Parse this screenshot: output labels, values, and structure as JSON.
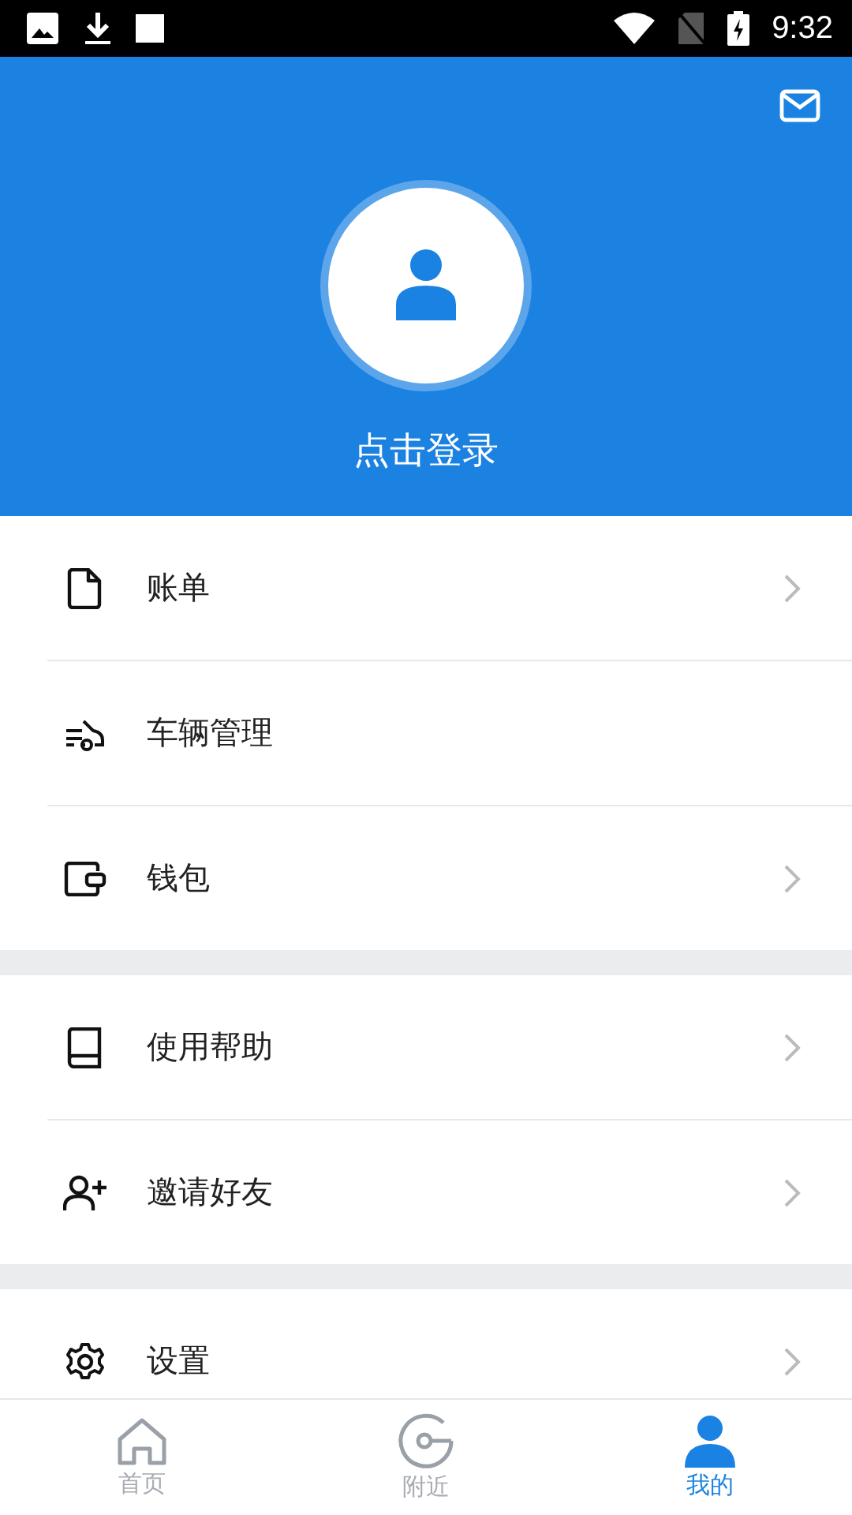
{
  "status_bar": {
    "time": "9:32"
  },
  "header": {
    "login_label": "点击登录"
  },
  "menu_groups": [
    {
      "items": [
        {
          "label": "账单",
          "kind": "document",
          "chevron": true
        },
        {
          "label": "车辆管理",
          "kind": "car",
          "chevron": false
        },
        {
          "label": "钱包",
          "kind": "wallet",
          "chevron": true
        }
      ]
    },
    {
      "items": [
        {
          "label": "使用帮助",
          "kind": "book",
          "chevron": true
        },
        {
          "label": "邀请好友",
          "kind": "person-add",
          "chevron": true
        }
      ]
    },
    {
      "items": [
        {
          "label": "设置",
          "kind": "gear",
          "chevron": true
        }
      ]
    }
  ],
  "bottom_nav": [
    {
      "label": "首页",
      "kind": "home",
      "selected": false
    },
    {
      "label": "附近",
      "kind": "target",
      "selected": false
    },
    {
      "label": "我的",
      "kind": "person",
      "selected": true
    }
  ]
}
